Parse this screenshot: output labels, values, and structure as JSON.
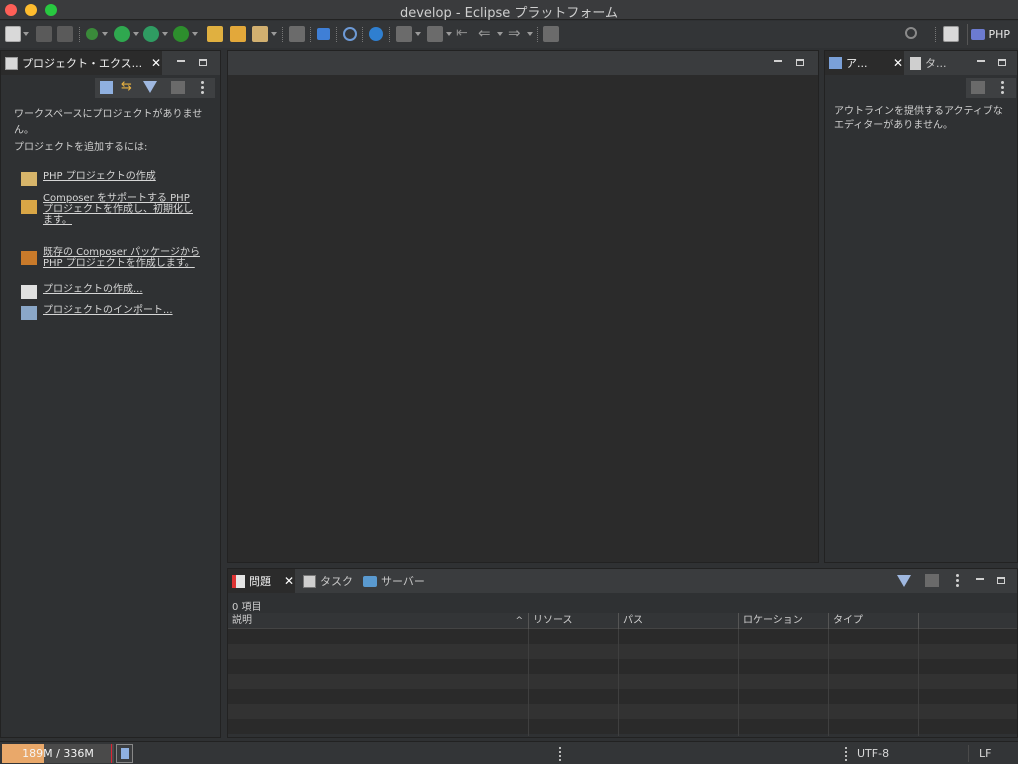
{
  "window": {
    "title": "develop - Eclipse プラットフォーム"
  },
  "toolbar": {
    "perspective_label": "PHP",
    "icons": [
      "new-icon",
      "save-icon",
      "save-all-icon",
      "debug-icon",
      "run-icon",
      "coverage-icon",
      "external-tools-icon",
      "new-php-project-icon",
      "open-type-icon",
      "open-task-icon",
      "annotation-icon",
      "terminal-icon",
      "skip-breakpoints-icon",
      "settings-icon",
      "next-annotation-icon",
      "previous-annotation-icon",
      "back-icon",
      "forward-icon",
      "pin-editor-icon",
      "search-icon",
      "open-perspective-icon",
      "php-perspective-icon"
    ]
  },
  "project_explorer": {
    "tab_label": "プロジェクト・エクス...",
    "no_projects_line1": "ワークスペースにプロジェクトがありませ",
    "no_projects_line2": "ん。",
    "add_heading": "プロジェクトを追加するには:",
    "links": [
      {
        "lines": [
          "PHP プロジェクトの作成"
        ],
        "icon": "new-php-project-icon"
      },
      {
        "lines": [
          "Composer をサポートする PHP ",
          "プロジェクトを作成し、初期化し",
          "ます。"
        ],
        "icon": "composer-project-icon"
      },
      {
        "lines": [
          "既存の Composer パッケージから",
          "PHP プロジェクトを作成します。"
        ],
        "icon": "composer-package-icon"
      },
      {
        "lines": [
          "プロジェクトの作成..."
        ],
        "icon": "new-project-icon"
      },
      {
        "lines": [
          "プロジェクトのインポート..."
        ],
        "icon": "import-project-icon"
      }
    ]
  },
  "outline": {
    "tab_label": "ア...",
    "tab2_label": "タ...",
    "message_line1": "アウトラインを提供するアクティブな",
    "message_line2": "エディターがありません。"
  },
  "problems": {
    "tabs": [
      "問題",
      "タスク",
      "サーバー"
    ],
    "item_count": "0 項目",
    "columns": [
      "説明",
      "リソース",
      "パス",
      "ロケーション",
      "タイプ"
    ]
  },
  "status": {
    "heap": "189M / 336M",
    "heap_used_fraction": 0.11,
    "heap_committed_fraction": 0.97,
    "encoding": "UTF-8",
    "line_delimiter": "LF"
  },
  "colors": {
    "accent": "#e9a86a",
    "background": "#2f3133"
  }
}
